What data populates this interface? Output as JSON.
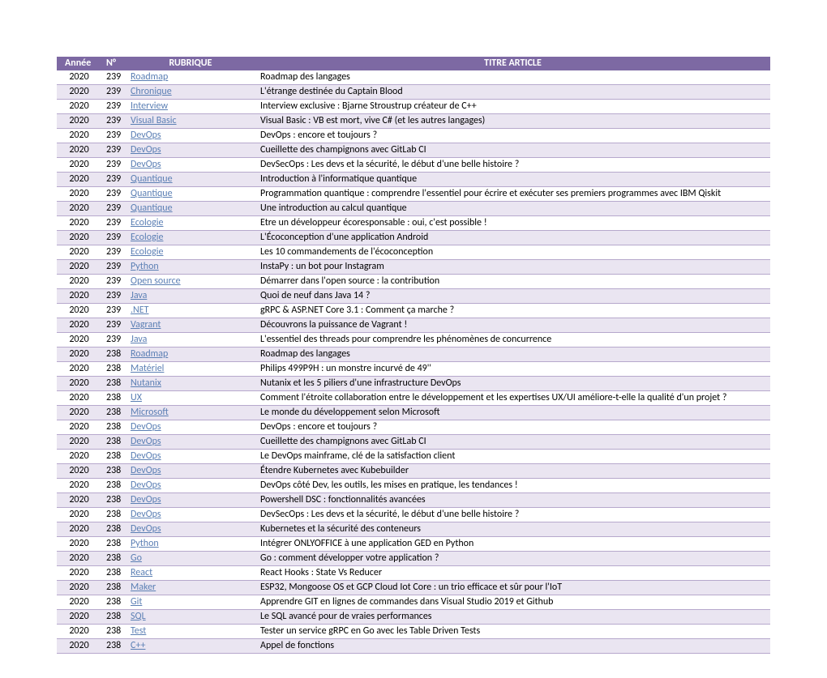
{
  "headers": {
    "annee": "Année",
    "num": "N°",
    "rubrique": "RUBRIQUE",
    "titre": "TITRE ARTICLE"
  },
  "rows": [
    {
      "annee": "2020",
      "num": "239",
      "rubrique": "Roadmap",
      "titre": "Roadmap des langages"
    },
    {
      "annee": "2020",
      "num": "239",
      "rubrique": "Chronique",
      "titre": "L'étrange destinée du Captain Blood"
    },
    {
      "annee": "2020",
      "num": "239",
      "rubrique": "Interview",
      "titre": "Interview exclusive : Bjarne Stroustrup créateur de C++"
    },
    {
      "annee": "2020",
      "num": "239",
      "rubrique": "Visual Basic",
      "titre": "Visual Basic : VB est mort, vive C# (et les autres langages)"
    },
    {
      "annee": "2020",
      "num": "239",
      "rubrique": "DevOps",
      "titre": "DevOps : encore et toujours ?"
    },
    {
      "annee": "2020",
      "num": "239",
      "rubrique": "DevOps",
      "titre": "Cueillette des champignons avec GitLab CI"
    },
    {
      "annee": "2020",
      "num": "239",
      "rubrique": "DevOps",
      "titre": "DevSecOps : Les devs et la sécurité, le début d'une belle histoire ?"
    },
    {
      "annee": "2020",
      "num": "239",
      "rubrique": "Quantique",
      "titre": "Introduction à l'informatique quantique"
    },
    {
      "annee": "2020",
      "num": "239",
      "rubrique": "Quantique",
      "titre": "Programmation quantique : comprendre l'essentiel pour écrire et exécuter ses premiers programmes avec IBM Qiskit"
    },
    {
      "annee": "2020",
      "num": "239",
      "rubrique": "Quantique",
      "titre": "Une introduction au calcul quantique"
    },
    {
      "annee": "2020",
      "num": "239",
      "rubrique": "Ecologie",
      "titre": "Etre un développeur écoresponsable : oui, c'est possible !"
    },
    {
      "annee": "2020",
      "num": "239",
      "rubrique": "Ecologie",
      "titre": "L'Écoconception d'une application Android"
    },
    {
      "annee": "2020",
      "num": "239",
      "rubrique": "Ecologie",
      "titre": "Les 10 commandements de l'écoconception"
    },
    {
      "annee": "2020",
      "num": "239",
      "rubrique": "Python",
      "titre": "InstaPy : un bot pour Instagram"
    },
    {
      "annee": "2020",
      "num": "239",
      "rubrique": "Open source",
      "titre": "Démarrer dans l'open source : la contribution"
    },
    {
      "annee": "2020",
      "num": "239",
      "rubrique": "Java",
      "titre": "Quoi de neuf dans Java 14 ?"
    },
    {
      "annee": "2020",
      "num": "239",
      "rubrique": ".NET",
      "titre": "gRPC & ASP.NET Core 3.1 : Comment ça marche ?"
    },
    {
      "annee": "2020",
      "num": "239",
      "rubrique": "Vagrant",
      "titre": "Découvrons la puissance de Vagrant !"
    },
    {
      "annee": "2020",
      "num": "239",
      "rubrique": "Java",
      "titre": "L'essentiel des threads pour comprendre les phénomènes de concurrence"
    },
    {
      "annee": "2020",
      "num": "238",
      "rubrique": "Roadmap",
      "titre": "Roadmap des langages"
    },
    {
      "annee": "2020",
      "num": "238",
      "rubrique": "Matériel",
      "titre": "Philips 499P9H : un monstre incurvé de 49''"
    },
    {
      "annee": "2020",
      "num": "238",
      "rubrique": "Nutanix",
      "titre": "Nutanix et les 5 piliers d'une infrastructure DevOps"
    },
    {
      "annee": "2020",
      "num": "238",
      "rubrique": "UX",
      "titre": "Comment l'étroite collaboration entre le développement et les expertises UX/UI améliore-t-elle la qualité d'un projet ?"
    },
    {
      "annee": "2020",
      "num": "238",
      "rubrique": "Microsoft",
      "titre": "Le monde du développement selon Microsoft"
    },
    {
      "annee": "2020",
      "num": "238",
      "rubrique": "DevOps",
      "titre": "DevOps : encore et toujours ?"
    },
    {
      "annee": "2020",
      "num": "238",
      "rubrique": "DevOps",
      "titre": "Cueillette des champignons avec GitLab CI"
    },
    {
      "annee": "2020",
      "num": "238",
      "rubrique": "DevOps",
      "titre": "Le DevOps mainframe, clé de la satisfaction client"
    },
    {
      "annee": "2020",
      "num": "238",
      "rubrique": "DevOps",
      "titre": "Étendre Kubernetes avec Kubebuilder"
    },
    {
      "annee": "2020",
      "num": "238",
      "rubrique": "DevOps",
      "titre": "DevOps côté Dev, les outils, les mises en pratique, les tendances !"
    },
    {
      "annee": "2020",
      "num": "238",
      "rubrique": "DevOps",
      "titre": "Powershell DSC : fonctionnalités avancées"
    },
    {
      "annee": "2020",
      "num": "238",
      "rubrique": "DevOps",
      "titre": "DevSecOps : Les devs et la sécurité, le début d'une belle histoire ?"
    },
    {
      "annee": "2020",
      "num": "238",
      "rubrique": "DevOps",
      "titre": "Kubernetes et la sécurité des conteneurs"
    },
    {
      "annee": "2020",
      "num": "238",
      "rubrique": "Python",
      "titre": "Intégrer ONLYOFFICE à une application GED en Python"
    },
    {
      "annee": "2020",
      "num": "238",
      "rubrique": "Go",
      "titre": "Go : comment développer votre application ?"
    },
    {
      "annee": "2020",
      "num": "238",
      "rubrique": "React",
      "titre": "React Hooks : State Vs Reducer"
    },
    {
      "annee": "2020",
      "num": "238",
      "rubrique": "Maker",
      "titre": "ESP32, Mongoose OS et GCP Cloud Iot Core : un trio efficace et sûr pour l'IoT"
    },
    {
      "annee": "2020",
      "num": "238",
      "rubrique": "Git",
      "titre": "Apprendre GIT en lignes de commandes dans Visual Studio 2019 et Github"
    },
    {
      "annee": "2020",
      "num": "238",
      "rubrique": "SQL",
      "titre": "Le SQL avancé pour de vraies performances"
    },
    {
      "annee": "2020",
      "num": "238",
      "rubrique": "Test",
      "titre": "Tester un service gRPC en Go avec les Table Driven Tests"
    },
    {
      "annee": "2020",
      "num": "238",
      "rubrique": "C++",
      "titre": "Appel de fonctions"
    }
  ]
}
